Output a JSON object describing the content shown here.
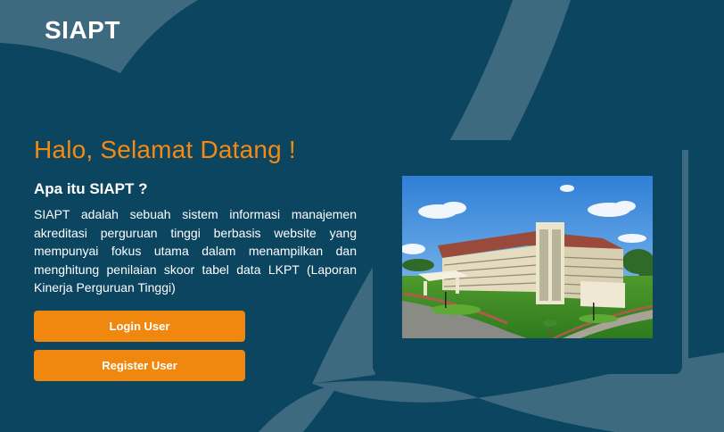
{
  "header": {
    "brand": "SIAPT"
  },
  "hero": {
    "headline": "Halo, Selamat Datang !",
    "subheading": "Apa itu SIAPT ?",
    "description": "SIAPT adalah sebuah sistem informasi manajemen akreditasi perguruan tinggi berbasis website yang mempunyai fokus utama dalam menampilkan dan menghitung penilaian skoor tabel data LKPT (Laporan Kinerja Perguruan Tinggi)"
  },
  "actions": {
    "login_label": "Login User",
    "register_label": "Register User"
  },
  "illustration": {
    "subject": "campus-building-photo"
  },
  "colors": {
    "background": "#0b4560",
    "shape": "#3d6a7e",
    "accent": "#f0870f",
    "text": "#ffffff"
  }
}
